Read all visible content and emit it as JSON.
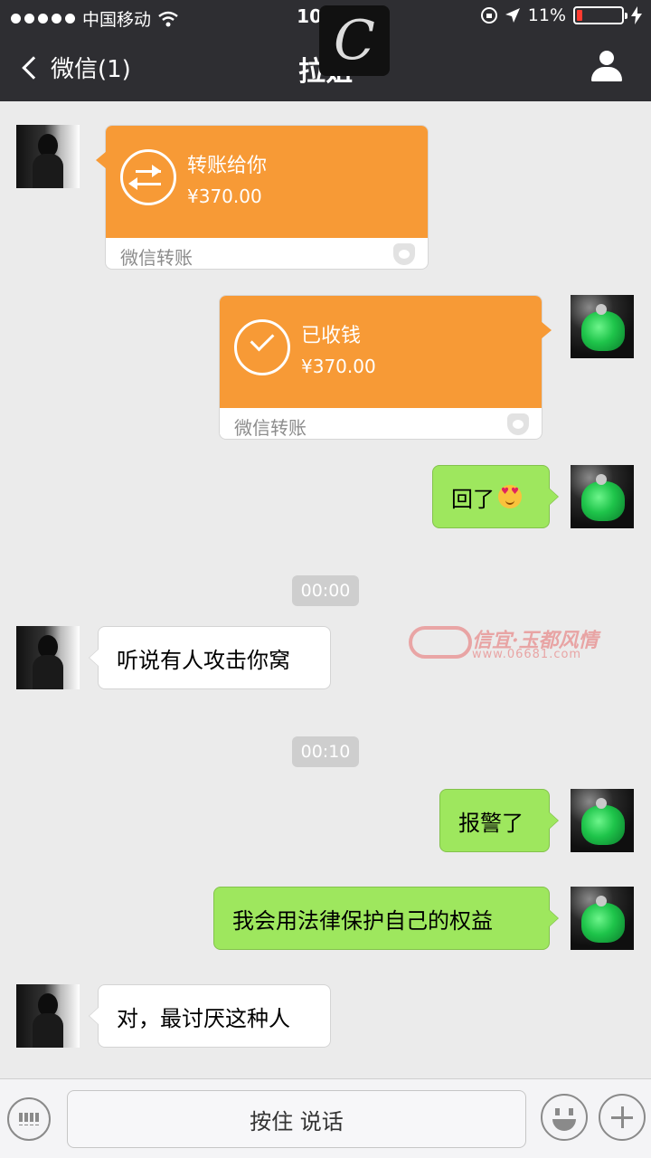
{
  "status": {
    "carrier": "中国移动",
    "time": "10:27",
    "battery": "11%"
  },
  "nav": {
    "back_label": "微信(1)",
    "title": "拉姐",
    "overlay_glyph": "C"
  },
  "messages": {
    "transfer_in": {
      "title": "转账给你",
      "amount": "¥370.00",
      "footer": "微信转账"
    },
    "transfer_out": {
      "title": "已收钱",
      "amount": "¥370.00",
      "footer": "微信转账"
    },
    "reply": "回了",
    "time1": "00:00",
    "friend1": "听说有人攻击你窝",
    "time2": "00:10",
    "me2": "报警了",
    "me3": "我会用法律保护自己的权益",
    "friend2": "对，最讨厌这种人"
  },
  "watermark": {
    "title": "信宜·玉都风情",
    "url": "www.06681.com"
  },
  "input": {
    "hold_to_talk": "按住 说话"
  },
  "colors": {
    "nav_bg": "#2e2e32",
    "transfer": "#f79a36",
    "my_bubble": "#9ee75e",
    "chat_bg": "#ebebeb"
  }
}
